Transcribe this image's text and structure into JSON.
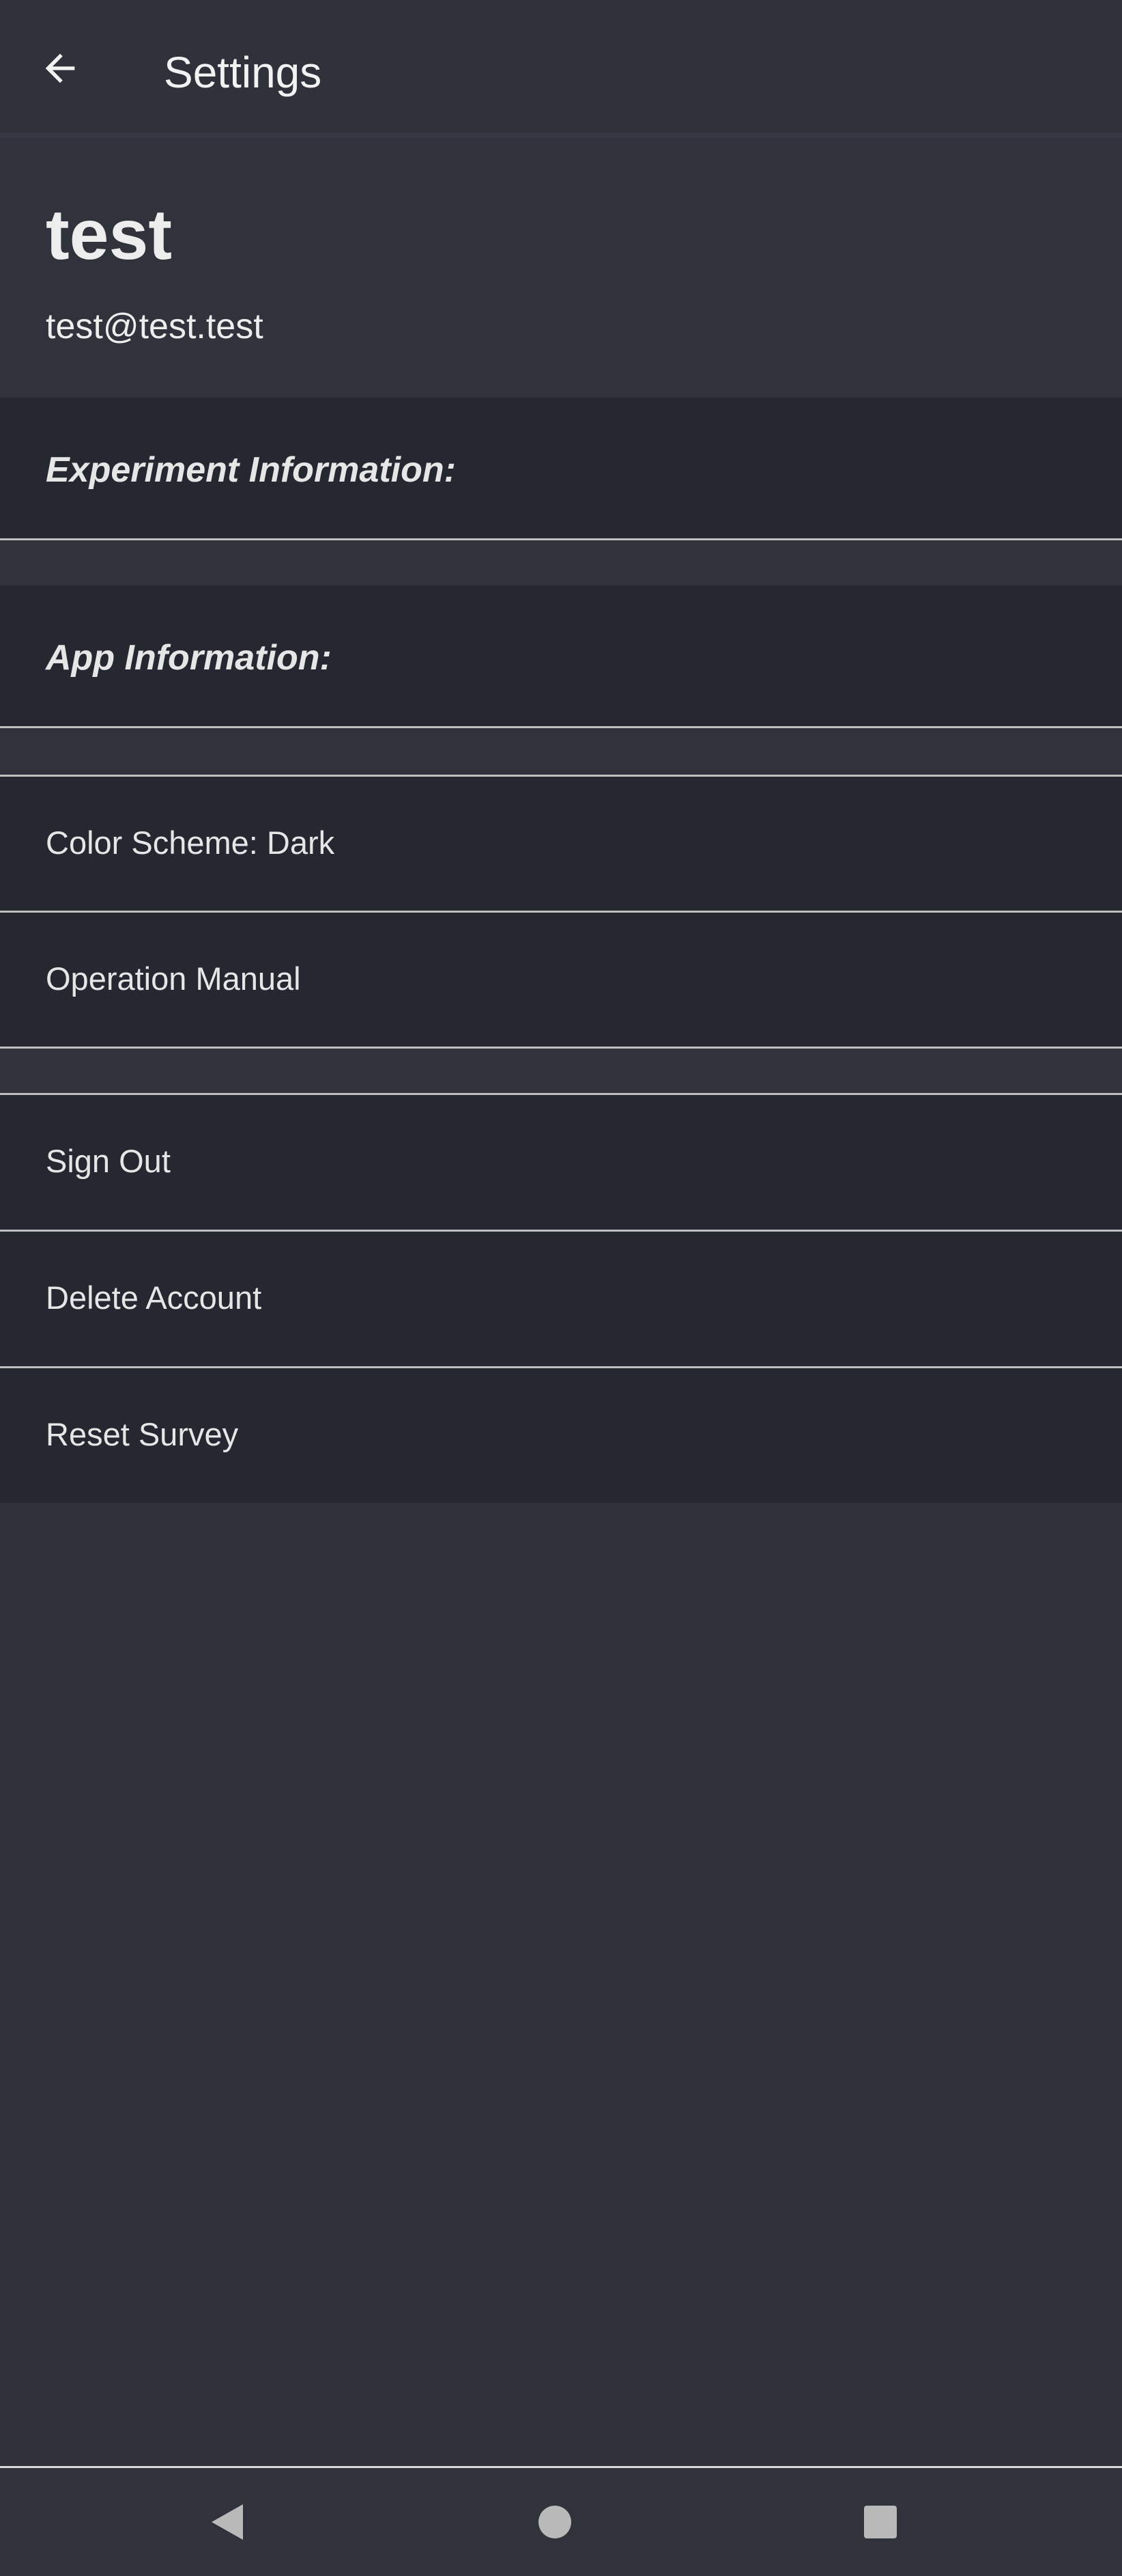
{
  "header": {
    "title": "Settings",
    "back_icon": "arrow-left-icon"
  },
  "profile": {
    "name": "test",
    "email": "test@test.test"
  },
  "sections": {
    "experiment_information": "Experiment Information:",
    "app_information": "App Information:"
  },
  "settings": {
    "color_scheme": "Color Scheme: Dark",
    "operation_manual": "Operation Manual"
  },
  "account": {
    "sign_out": "Sign Out",
    "delete_account": "Delete Account",
    "reset_survey": "Reset Survey"
  },
  "nav": {
    "back_icon": "triangle-back-icon",
    "home_icon": "circle-home-icon",
    "recents_icon": "square-recents-icon"
  },
  "colors": {
    "background": "#2f323b",
    "row_background": "#252831",
    "divider": "#bfbfbf",
    "text": "#ececec"
  }
}
